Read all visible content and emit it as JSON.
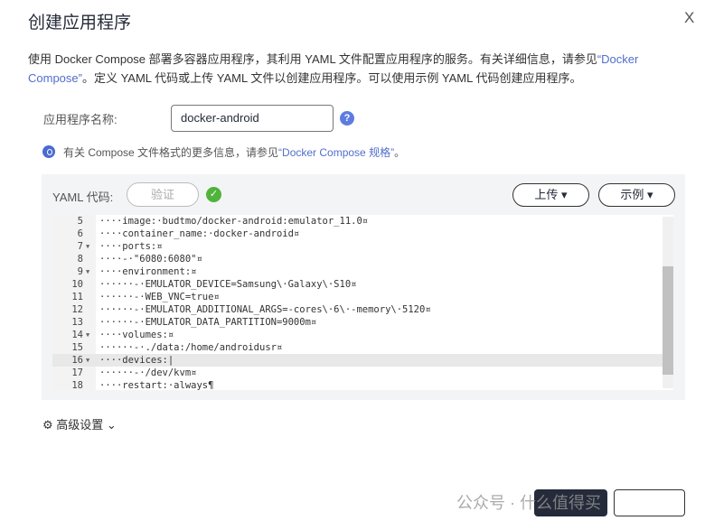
{
  "dialog": {
    "title": "创建应用程序",
    "close": "X"
  },
  "description": {
    "part1": "使用 Docker Compose 部署多容器应用程序，其利用 YAML 文件配置应用程序的服务。有关详细信息，请参见",
    "link": "“Docker Compose”",
    "part2": "。定义 YAML 代码或上传 YAML 文件以创建应用程序。可以使用示例 YAML 代码创建应用程序。"
  },
  "form": {
    "name_label": "应用程序名称:",
    "name_value": "docker-android",
    "help": "?"
  },
  "info": {
    "prefix": "有关 Compose 文件格式的更多信息，请参见",
    "link": "“Docker Compose 规格”",
    "suffix": "。"
  },
  "yaml": {
    "label": "YAML 代码:",
    "verify": "验证",
    "upload": "上传 ▾",
    "example": "示例 ▾",
    "lines": [
      {
        "n": "5",
        "fold": "",
        "code": "····image:·budtmo/docker-android:emulator_11.0¤"
      },
      {
        "n": "6",
        "fold": "",
        "code": "····container_name:·docker-android¤"
      },
      {
        "n": "7",
        "fold": "▼",
        "code": "····ports:¤"
      },
      {
        "n": "8",
        "fold": "",
        "code": "····-·\"6080:6080\"¤"
      },
      {
        "n": "9",
        "fold": "▼",
        "code": "····environment:¤"
      },
      {
        "n": "10",
        "fold": "",
        "code": "······-·EMULATOR_DEVICE=Samsung\\·Galaxy\\·S10¤"
      },
      {
        "n": "11",
        "fold": "",
        "code": "······-·WEB_VNC=true¤"
      },
      {
        "n": "12",
        "fold": "",
        "code": "······-·EMULATOR_ADDITIONAL_ARGS=-cores\\·6\\·-memory\\·5120¤"
      },
      {
        "n": "13",
        "fold": "",
        "code": "······-·EMULATOR_DATA_PARTITION=9000m¤"
      },
      {
        "n": "14",
        "fold": "▼",
        "code": "····volumes:¤"
      },
      {
        "n": "15",
        "fold": "",
        "code": "······-·./data:/home/androidusr¤"
      },
      {
        "n": "16",
        "fold": "▼",
        "code": "····devices:|"
      },
      {
        "n": "17",
        "fold": "",
        "code": "······-·/dev/kvm¤"
      },
      {
        "n": "18",
        "fold": "",
        "code": "····restart:·always¶"
      }
    ]
  },
  "advanced": {
    "label": "高级设置 ⌄"
  },
  "watermark": "公众号 · 什么值得买"
}
